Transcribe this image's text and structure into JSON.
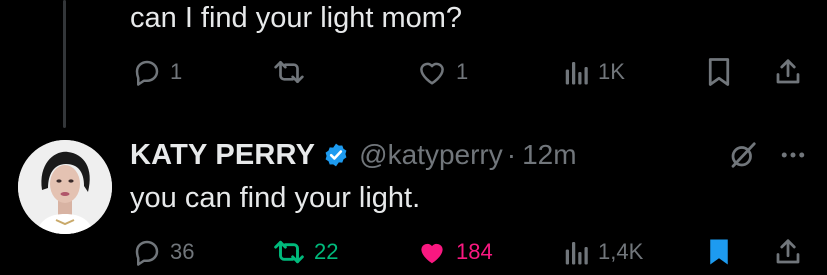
{
  "colors": {
    "background": "#000000",
    "text": "#e7e9ea",
    "muted": "#71767b",
    "verified": "#1d9bf0",
    "retweet_active": "#00ba7c",
    "like_active": "#f91880",
    "bookmark_active": "#1d9bf0",
    "thread_line": "#333639"
  },
  "parent_tweet": {
    "text": "can I find your light mom?",
    "actions": {
      "reply_count": "1",
      "retweet_count": "",
      "like_count": "1",
      "view_count": "1K"
    },
    "icons": [
      "reply-icon",
      "retweet-icon",
      "like-icon",
      "views-icon",
      "bookmark-icon",
      "share-icon"
    ]
  },
  "reply_tweet": {
    "display_name": "KATY PERRY",
    "handle": "@katyperry",
    "separator": "·",
    "timestamp": "12m",
    "text": "you can find your light.",
    "verified": true,
    "actions": {
      "reply_count": "36",
      "retweet_count": "22",
      "retweeted": true,
      "like_count": "184",
      "liked": true,
      "view_count": "1,4K",
      "bookmarked": true
    },
    "icons": [
      "verified-badge-icon",
      "grok-icon",
      "more-icon",
      "reply-icon",
      "retweet-icon",
      "like-icon",
      "views-icon",
      "bookmark-icon",
      "share-icon"
    ]
  }
}
